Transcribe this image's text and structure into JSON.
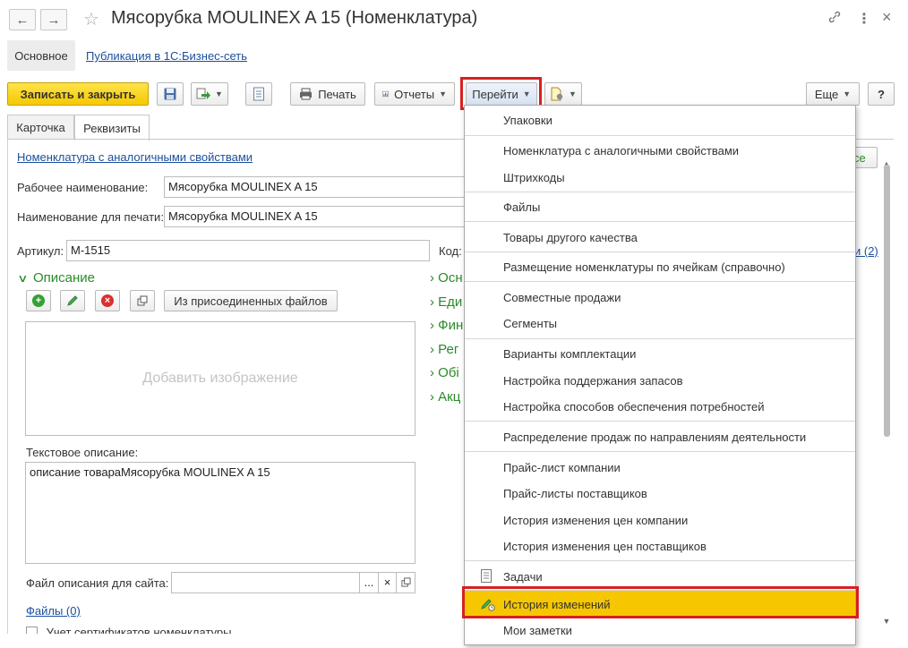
{
  "window": {
    "title": "Мясорубка MOULINEX  A 15 (Номенклатура)",
    "back_glyph": "←",
    "forward_glyph": "→",
    "star_glyph": "☆",
    "link_glyph": "🔗",
    "more_glyph": "⋮",
    "close_glyph": "×"
  },
  "nav": {
    "main": "Основное",
    "publication": "Публикация в 1С:Бизнес-сеть"
  },
  "toolbar": {
    "save_close": "Записать и закрыть",
    "print": "Печать",
    "reports": "Отчеты",
    "goto": "Перейти",
    "more": "Еще",
    "help": "?"
  },
  "tabs": [
    "Карточка",
    "Реквизиты"
  ],
  "form": {
    "analogs_link": "Номенклатура с аналогичными свойствами",
    "working_name_label": "Рабочее наименование:",
    "working_name_value": "Мясорубка MOULINEX  A 15",
    "print_name_label": "Наименование для печати:",
    "print_name_value": "Мясорубка MOULINEX  A 15",
    "article_label": "Артикул:",
    "article_value": "М-1515",
    "code_label": "Код:",
    "description_section": "Описание",
    "from_files_button": "Из присоединенных файлов",
    "add_image": "Добавить изображение",
    "text_desc_label": "Текстовое описание:",
    "text_desc_value": "описание товараМясорубка MOULINEX  A 15",
    "site_file_label": "Файл описания для сайта:",
    "files_link": "Файлы (0)",
    "certs_label": "Учет сертификатов номенклатуры",
    "right_partial_button": "се",
    "right_partial_link": "и (2)"
  },
  "right_sections": [
    "Осн",
    "Еди",
    "Фин",
    "Рег",
    "Обі",
    "Акц"
  ],
  "menu": {
    "items": [
      "Упаковки",
      "Номенклатура с аналогичными свойствами",
      "Штрихкоды",
      "Файлы",
      "Товары другого качества",
      "Размещение номенклатуры по ячейкам (справочно)",
      "Совместные продажи",
      "Сегменты",
      "Варианты комплектации",
      "Настройка поддержания запасов",
      "Настройка способов обеспечения потребностей",
      "Распределение продаж по направлениям деятельности",
      "Прайс-лист компании",
      "Прайс-листы поставщиков",
      "История изменения цен компании",
      "История изменения цен поставщиков",
      "Задачи",
      "История изменений",
      "Мои заметки"
    ],
    "highlighted": "История изменений",
    "highlight_color": "#f6c700"
  },
  "colors": {
    "primary_button": "#f5c800",
    "link": "#1b4f9c",
    "section_green": "#2a8a2a",
    "red_frame": "#d62020"
  }
}
